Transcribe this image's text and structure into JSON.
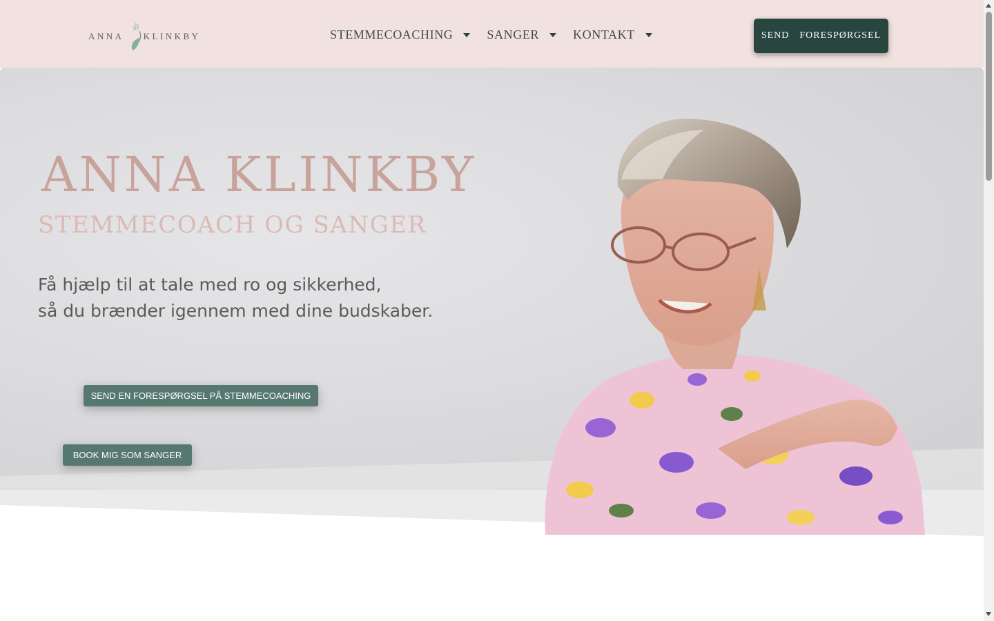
{
  "header": {
    "logo": {
      "left": "ANNA",
      "right": "KLINKBY"
    },
    "nav": [
      {
        "label": "STEMMECOACHING"
      },
      {
        "label": "SANGER"
      },
      {
        "label": "KONTAKT"
      }
    ],
    "cta_label": "SEND  FORESPØRGSEL"
  },
  "hero": {
    "title": "ANNA KLINKBY",
    "subtitle": "STEMMECOACH OG SANGER",
    "text_line1": "Få hjælp til at tale med ro og sikkerhed,",
    "text_line2": "så du brænder igennem med dine budskaber.",
    "cta_coaching": "SEND EN FORESPØRGSEL PÅ STEMMECOACHING",
    "cta_singer": "BOOK MIG SOM SANGER"
  },
  "colors": {
    "header_bg": "#f1e2df",
    "brand_dark_green": "#294540",
    "button_green": "#56786f",
    "title_rose": "#c7a39c"
  },
  "icons": {
    "logo_mark": "leaf-icon",
    "nav_caret": "caret-down-icon"
  }
}
